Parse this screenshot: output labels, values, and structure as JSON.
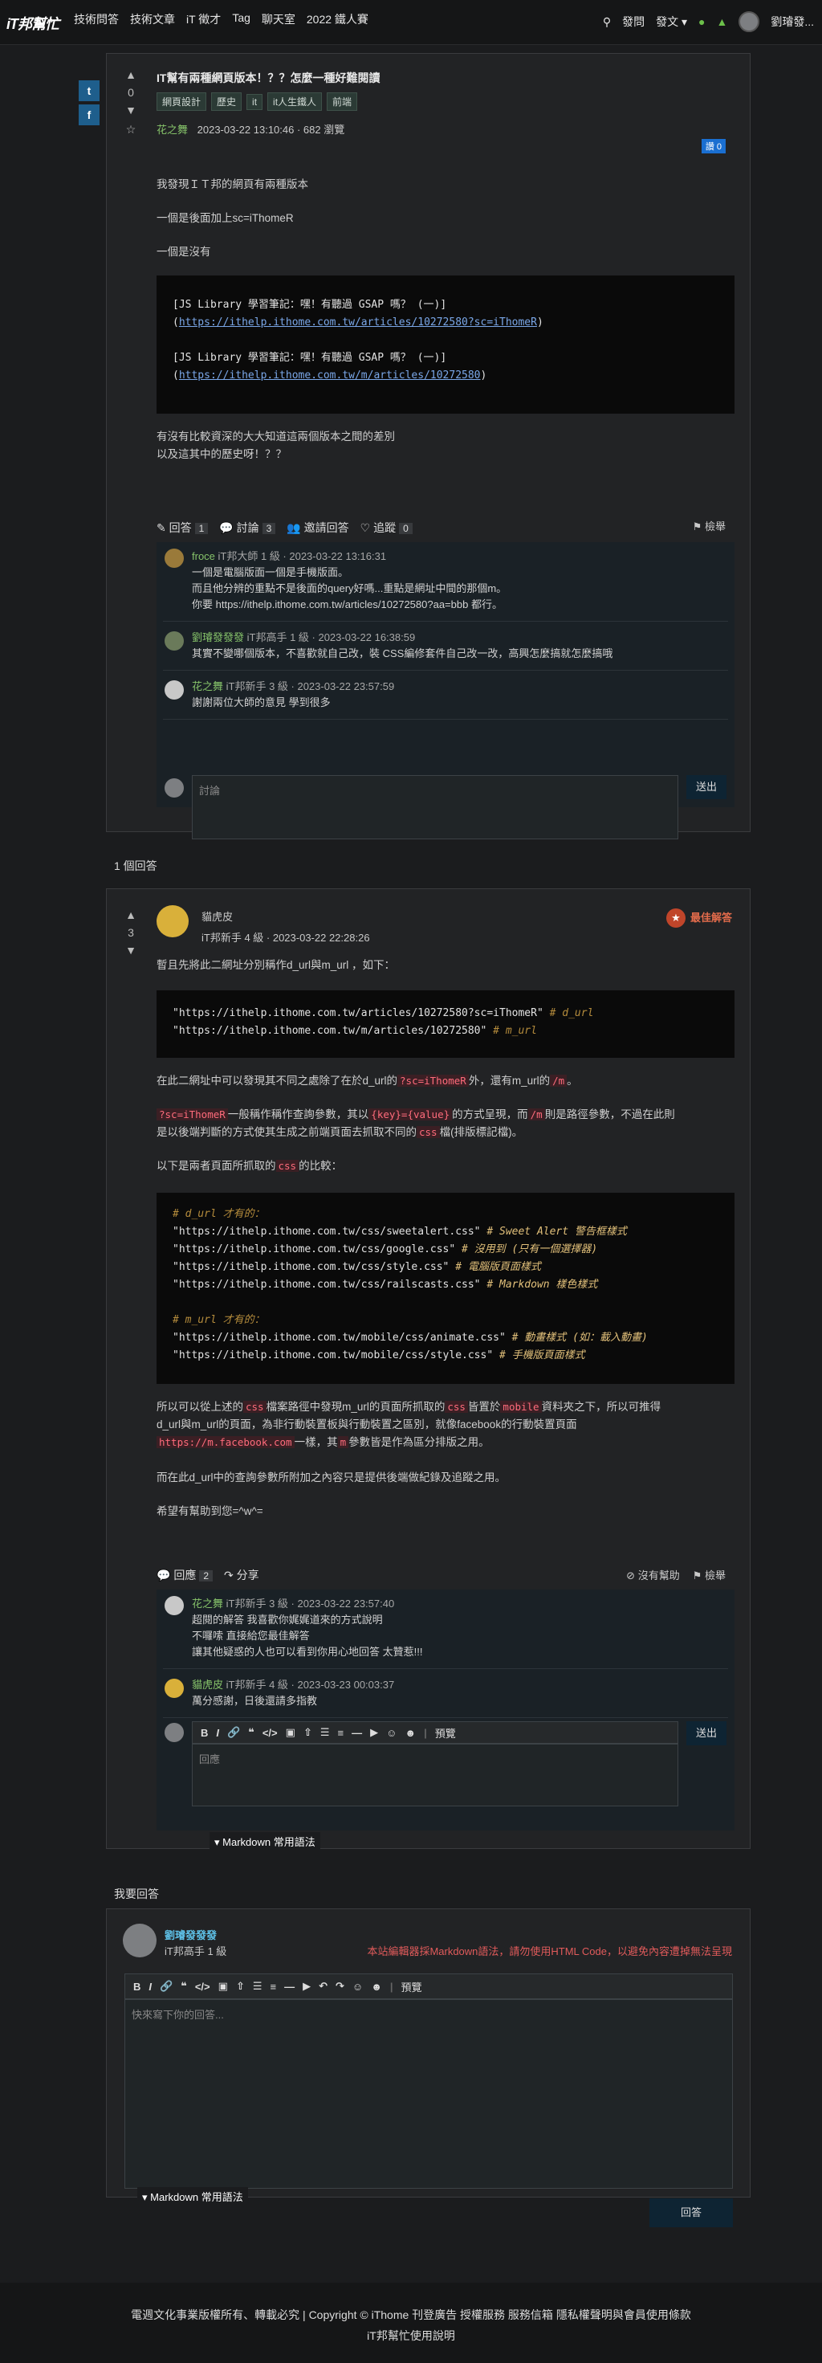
{
  "nav": {
    "logo": "iT邦幫忙",
    "links": [
      "技術問答",
      "技術文章",
      "iT 徵才",
      "Tag",
      "聊天室",
      "2022 鐵人賽"
    ],
    "ask": "發問",
    "post": "發文",
    "user": "劉璿發..."
  },
  "share": {
    "twitter": "t",
    "facebook": "f"
  },
  "question": {
    "vote": "0",
    "title": "IT幫有兩種網頁版本！？？怎麼一種好難閱讀",
    "tags": [
      "網頁設計",
      "歷史",
      "it",
      "it人生鐵人",
      "前端"
    ],
    "author": "花之舞",
    "meta": "2023-03-22 13:10:46 · 682 瀏覽",
    "like": "讚 0",
    "p1": "我發現ＩＴ邦的網頁有兩種版本",
    "p2": "一個是後面加上sc=iThomeR",
    "p3": "一個是沒有",
    "code1a": "[JS Library 學習筆記：嘿！有聽過 GSAP 嗎？ (一)](",
    "link1a": "https://ithelp.ithome.com.tw/articles/10272580?sc=iThomeR",
    "code1b": ")",
    "code2a": "[JS Library 學習筆記：嘿！有聽過 GSAP 嗎？ (一)](",
    "link2a": "https://ithelp.ithome.com.tw/m/articles/10272580",
    "code2b": ")",
    "p4": "有沒有比較資深的大大知道這兩個版本之間的差別",
    "p5": "以及這其中的歷史呀！？？",
    "actions": {
      "answer": "回答",
      "answer_count": "1",
      "discuss": "討論",
      "discuss_count": "3",
      "invite": "邀請回答",
      "follow": "追蹤",
      "follow_count": "0",
      "report": "檢舉"
    },
    "comments": [
      {
        "name": "froce",
        "level": "iT邦大師 1 級 · 2023-03-22 13:16:31",
        "lines": [
          "一個是電腦版面一個是手機版面。",
          "而且他分辨的重點不是後面的query好嗎...重點是網址中間的那個m。",
          "你要 https://ithelp.ithome.com.tw/articles/10272580?aa=bbb 都行。"
        ]
      },
      {
        "name": "劉璿發發發",
        "level": "iT邦高手 1 級 · 2023-03-22 16:38:59",
        "lines": [
          "其實不變哪個版本，不喜歡就自己改，裝 CSS編修套件自己改一改，高興怎麼搞就怎麼搞哦"
        ]
      },
      {
        "name": "花之舞",
        "level": "iT邦新手 3 級 · 2023-03-22 23:57:59",
        "lines": [
          "謝謝兩位大師的意見 學到很多"
        ]
      }
    ],
    "comment_placeholder": "討論",
    "send": "送出"
  },
  "answers_heading": "1 個回答",
  "answer": {
    "vote": "3",
    "author": "貓虎皮",
    "meta": "iT邦新手 4 級 · 2023-03-22 22:28:26",
    "best": "最佳解答",
    "p1": "暫且先將此二網址分別稱作d_url與m_url ，如下：",
    "code1": "\"https://ithelp.ithome.com.tw/articles/10272580?sc=iThomeR\"",
    "c1": "# d_url",
    "code2": "\"https://ithelp.ithome.com.tw/m/articles/10272580\"",
    "c2": "# m_url",
    "p2a": "在此二網址中可以發現其不同之處除了在於d_url的",
    "p2b": "?sc=iThomeR",
    "p2c": "外，還有m_url的",
    "p2d": "/m",
    "p2e": "。",
    "p3a": "?sc=iThomeR",
    "p3b": "一般稱作稱作查詢參數，其以",
    "p3c": "{key}={value}",
    "p3d": "的方式呈現，而",
    "p3e": "/m",
    "p3f": "則是路徑參數，不過在此則",
    "p3g": "是以後端判斷的方式使其生成之前端頁面去抓取不同的",
    "p3h": "css",
    "p3i": "檔(排版標記檔)。",
    "p4a": "以下是兩者頁面所抓取的",
    "p4b": "css",
    "p4c": "的比較：",
    "block": [
      {
        "t": "# d_url 才有的：",
        "c": ""
      },
      {
        "t": "\"https://ithelp.ithome.com.tw/css/sweetalert.css\"",
        "c": "# Sweet Alert 警告框樣式"
      },
      {
        "t": "\"https://ithelp.ithome.com.tw/css/google.css\"",
        "c": "# 沒用到 (只有一個選擇器)"
      },
      {
        "t": "\"https://ithelp.ithome.com.tw/css/style.css\"",
        "c": "# 電腦版頁面樣式"
      },
      {
        "t": "\"https://ithelp.ithome.com.tw/css/railscasts.css\"",
        "c": "# Markdown 樣色樣式"
      },
      {
        "t": "",
        "c": ""
      },
      {
        "t": "# m_url 才有的：",
        "c": ""
      },
      {
        "t": "\"https://ithelp.ithome.com.tw/mobile/css/animate.css\"",
        "c": "# 動畫樣式 (如：載入動畫)"
      },
      {
        "t": "\"https://ithelp.ithome.com.tw/mobile/css/style.css\"",
        "c": "# 手機版頁面樣式"
      }
    ],
    "p5a": "所以可以從上述的",
    "p5b": "css",
    "p5c": "檔案路徑中發現m_url的頁面所抓取的",
    "p5d": "css",
    "p5e": "皆置於",
    "p5f": "mobile",
    "p5g": "資料夾之下，所以可推得",
    "p5h": "d_url與m_url的頁面，為非行動裝置板與行動裝置之區別，就像facebook的行動裝置頁面",
    "p5i": "https://m.facebook.com",
    "p5j": "一樣，其",
    "p5k": "m",
    "p5l": "參數皆是作為區分排版之用。",
    "p6": "而在此d_url中的查詢參數所附加之內容只是提供後端做紀錄及追蹤之用。",
    "p7": "希望有幫助到您=^w^=",
    "actions": {
      "reply": "回應",
      "reply_count": "2",
      "share": "分享",
      "nohelp": "沒有幫助",
      "report": "檢舉"
    },
    "comments": [
      {
        "name": "花之舞",
        "level": "iT邦新手 3 級 · 2023-03-22 23:57:40",
        "lines": [
          "超閱的解答 我喜歡你娓娓道來的方式說明",
          "不囉嗦 直接給您最佳解答",
          "讓其他疑惑的人也可以看到你用心地回答 太贊惹!!!"
        ]
      },
      {
        "name": "貓虎皮",
        "level": "iT邦新手 4 級 · 2023-03-23 00:03:37",
        "lines": [
          "萬分感謝，日後還請多指教"
        ]
      }
    ],
    "toolbar_preview": "預覽",
    "reply_placeholder": "回應",
    "send": "送出",
    "md": "Markdown 常用語法"
  },
  "my_answer": {
    "heading": "我要回答",
    "user": "劉璿發發發",
    "level": "iT邦高手 1 級",
    "notice": "本站編輯器採Markdown語法，請勿使用HTML Code，以避免內容遭掉無法呈現",
    "preview": "預覽",
    "placeholder": "快來寫下你的回答...",
    "md": "Markdown 常用語法",
    "submit": "回答"
  },
  "footer": {
    "line1": "電週文化事業版權所有、轉載必究 | Copyright © iThome   刊登廣告   授權服務   服務信箱   隱私權聲明與會員使用條款",
    "line2": "iT邦幫忙使用說明"
  }
}
